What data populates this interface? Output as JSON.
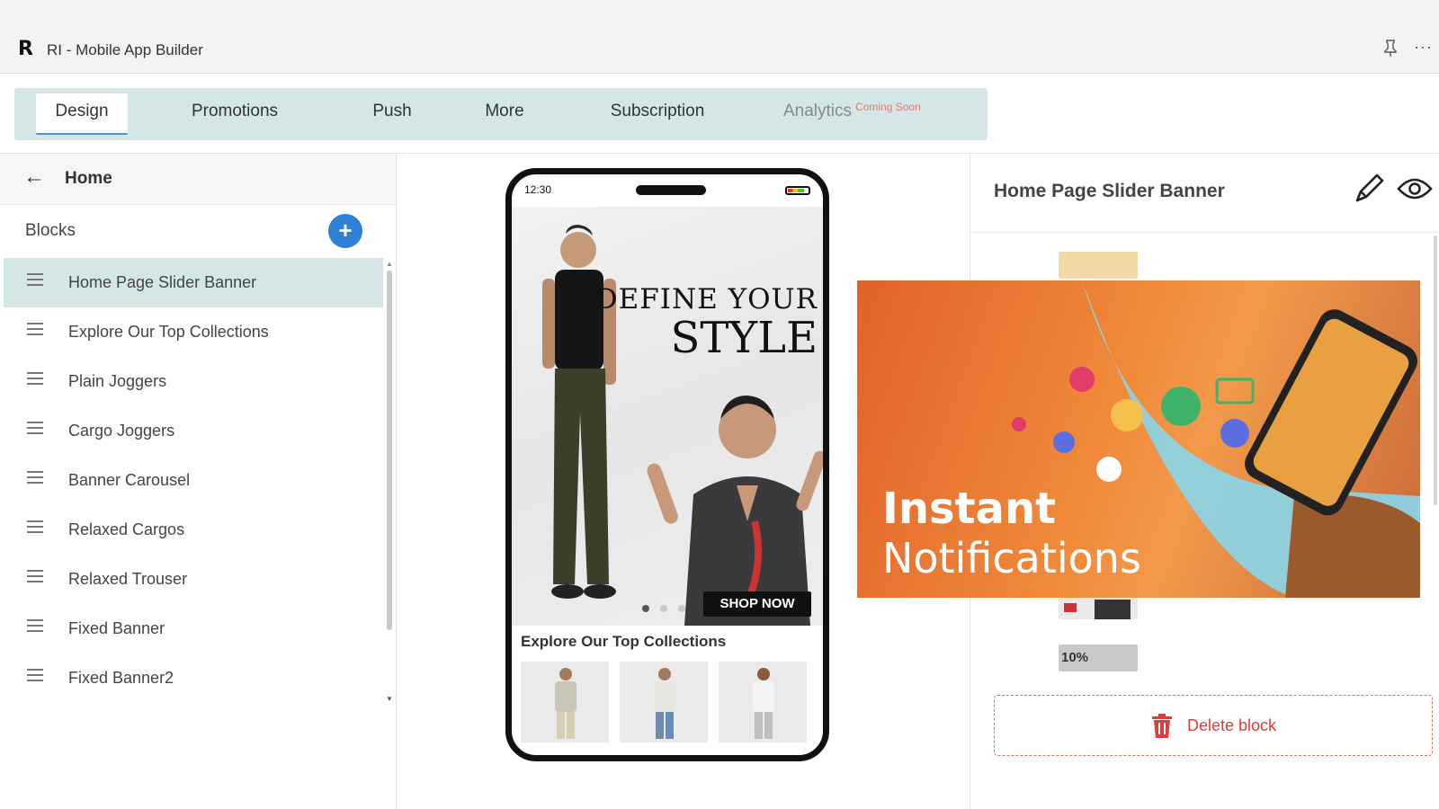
{
  "window": {
    "title": "RI - Mobile App Builder",
    "logo_text": "R",
    "pin_icon": "pin-icon",
    "more_icon": "more-options-icon",
    "more_glyph": "···"
  },
  "tabs": {
    "design": "Design",
    "promotions": "Promotions",
    "push": "Push",
    "more": "More",
    "subscription": "Subscription",
    "analytics": "Analytics",
    "analytics_badge": "Coming Soon"
  },
  "left_panel": {
    "back_icon": "arrow-left-icon",
    "back_glyph": "←",
    "page_title": "Home",
    "blocks_title": "Blocks",
    "add_glyph": "+",
    "blocks": [
      "Home Page Slider Banner",
      "Explore Our Top Collections",
      "Plain Joggers",
      "Cargo Joggers",
      "Banner Carousel",
      "Relaxed Cargos",
      "Relaxed Trouser",
      "Fixed Banner",
      "Fixed Banner2"
    ],
    "selected_index": 0
  },
  "phone": {
    "time": "12:30",
    "hero_line1": "DEFINE YOUR",
    "hero_line2": "STYLE",
    "cta": "SHOP NOW",
    "collections_title": "Explore Our Top Collections"
  },
  "right_panel": {
    "title": "Home Page Slider Banner",
    "delete_label": "Delete block",
    "thumb_label": "10%"
  },
  "promo": {
    "line1": "Instant",
    "line2": "Notifications"
  },
  "colors": {
    "accent": "#2e7fd6",
    "tab_bar": "#d4e6e6",
    "delete": "#e03c3c",
    "promo_orange": "#e0622a"
  }
}
